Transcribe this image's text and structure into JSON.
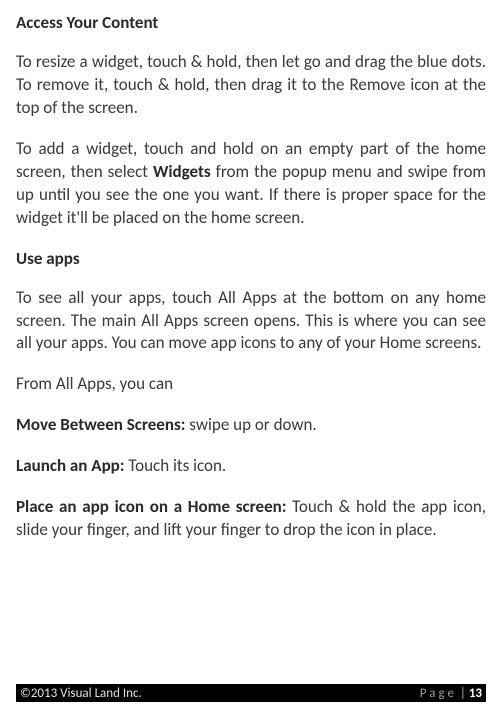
{
  "heading1": "Access Your Content",
  "para1": "To resize a widget, touch & hold, then let go and drag the blue dots. To remove it, touch & hold, then drag it to the Remove icon at the top of the screen.",
  "para2_pre": "To add a widget, touch and hold on an empty part of the home screen, then select ",
  "para2_bold": "Widgets",
  "para2_post": " from the popup menu and swipe from up until you see the one you want. If there is proper space for the widget it'll be placed on the home screen.",
  "heading2": "Use apps",
  "para3": "To see all your apps, touch All Apps at the bottom on any home screen. The main All Apps screen opens. This is where you can see all your apps. You can move app icons to any of your Home screens.",
  "para4": "From All Apps, you can",
  "para5_bold": "Move Between Screens:",
  "para5_post": " swipe up or down.",
  "para6_bold": "Launch an App:",
  "para6_post": " Touch its icon.",
  "para7_bold": "Place an app icon on a Home screen:",
  "para7_post": " Touch & hold the app icon, slide your finger, and lift your finger to drop the icon in place.",
  "footer_left": "©2013 Visual Land Inc.",
  "footer_page_label": "Page",
  "footer_separator": " | ",
  "footer_page_num": "13"
}
